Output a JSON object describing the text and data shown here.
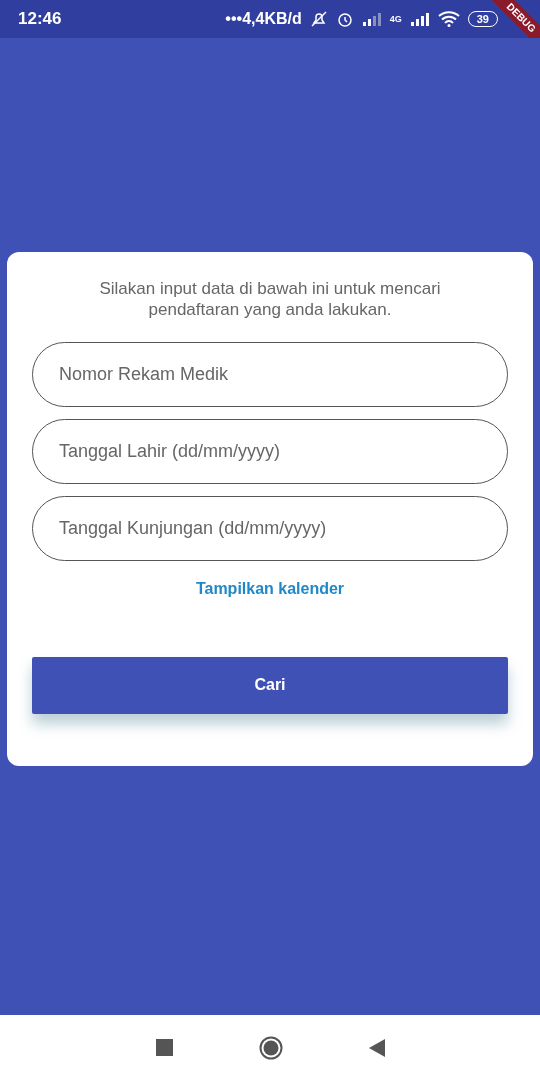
{
  "status_bar": {
    "time": "12:46",
    "network_speed": "•••4,4KB/d",
    "network_type": "4G",
    "battery": "39",
    "debug_banner": "DEBUG"
  },
  "form": {
    "instruction": "Silakan input data di bawah ini untuk mencari pendaftaran yang anda lakukan.",
    "fields": [
      {
        "placeholder": "Nomor Rekam Medik"
      },
      {
        "placeholder": "Tanggal Lahir (dd/mm/yyyy)"
      },
      {
        "placeholder": "Tanggal Kunjungan (dd/mm/yyyy)"
      }
    ],
    "calendar_link": "Tampilkan kalender",
    "submit_button": "Cari"
  }
}
